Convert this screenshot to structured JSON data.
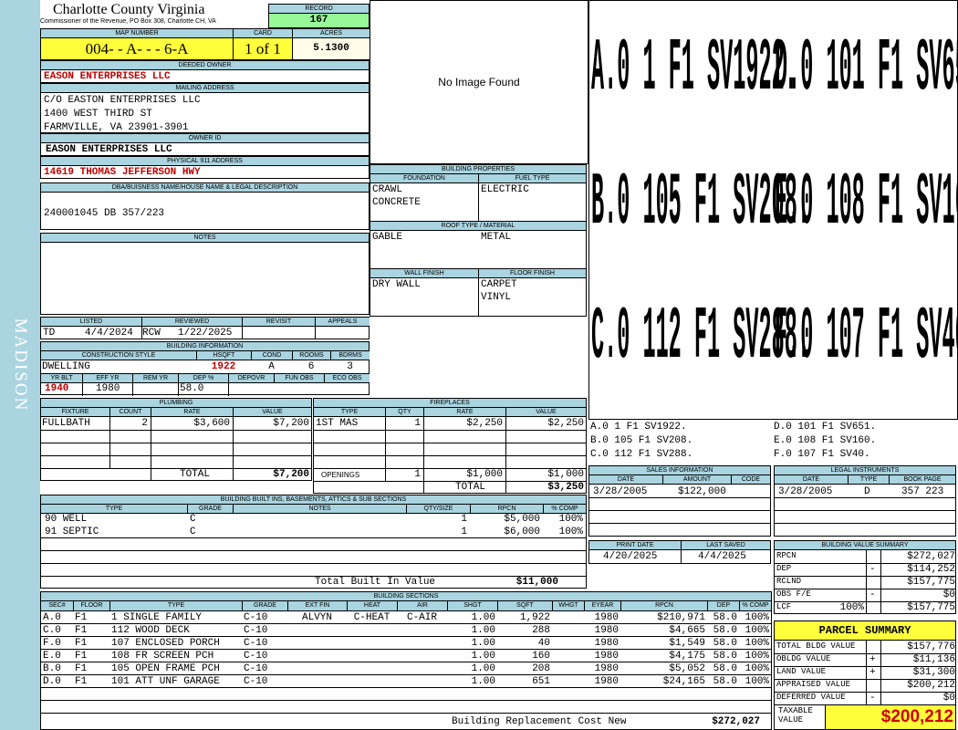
{
  "sidebar": {
    "label": "MADISON"
  },
  "header": {
    "county": "Charlotte County Virginia",
    "address": "Commissioner of the Revenue, PO Box 308, Charlotte CH, VA"
  },
  "record": {
    "label": "RECORD",
    "value": "167"
  },
  "map": {
    "label": "MAP NUMBER",
    "value": "004- - A- - - 6-A"
  },
  "card": {
    "label": "CARD",
    "value": "1 of 1"
  },
  "acres": {
    "label": "ACRES",
    "value": "5.1300"
  },
  "deeded_owner": {
    "label": "DEEDED OWNER",
    "value": "EASON ENTERPRISES LLC"
  },
  "mailing": {
    "label": "MAILING ADDRESS",
    "line1": "C/O EASTON ENTERPRISES LLC",
    "line2": "1400 WEST THIRD ST",
    "line3": "FARMVILLE, VA 23901-3901"
  },
  "owner_id": {
    "label": "OWNER ID",
    "value": "EASON ENTERPRISES LLC"
  },
  "physical": {
    "label": "PHYSICAL 911 ADDRESS",
    "value": "14619 THOMAS JEFFERSON HWY"
  },
  "dba": {
    "label": "DBA/BUISNESS NAME/HOUSE NAME & LEGAL DESCRIPTION",
    "value": "240001045 DB 357/223"
  },
  "notes": {
    "label": "NOTES"
  },
  "image": {
    "text": "No Image Found"
  },
  "building_props": {
    "title": "BUILDING PROPERTIES",
    "foundation_label": "FOUNDATION",
    "foundation1": "CRAWL",
    "foundation2": "CONCRETE",
    "fuel_label": "FUEL TYPE",
    "fuel": "ELECTRIC",
    "roof_label": "ROOF TYPE / MATERIAL",
    "roof_type": "GABLE",
    "roof_material": "METAL",
    "wall_label": "WALL FINISH",
    "wall": "DRY WALL",
    "floor_label": "FLOOR FINISH",
    "floor1": "CARPET",
    "floor2": "VINYL"
  },
  "sketch": {
    "labels": [
      "A.0 1 F1 SV1922.",
      "D.0 101 F1 SV651.",
      "B.0 105 F1 SV208.",
      "E.0 108 F1 SV160.",
      "C.0 112 F1 SV288.",
      "F.0 107 F1 SV40."
    ],
    "legend": [
      "A.0 1 F1 SV1922.",
      "D.0 101 F1 SV651.",
      "B.0 105 F1 SV208.",
      "E.0 108 F1 SV160.",
      "C.0 112 F1 SV288.",
      "F.0 107 F1 SV40."
    ]
  },
  "listed": {
    "listed_label": "LISTED",
    "reviewed_label": "REVIEWED",
    "revisit_label": "REVISIT",
    "appeals_label": "APPEALS",
    "listed_by": "TD",
    "listed_date": "4/4/2024",
    "reviewed_by": "RCW",
    "reviewed_date": "1/22/2025"
  },
  "building_info": {
    "title": "BUILDING INFORMATION",
    "style_label": "CONSTRUCTION STYLE",
    "style": "DWELLING",
    "hsqft_label": "HSQFT",
    "hsqft": "1922",
    "cond_label": "COND",
    "cond": "A",
    "rooms_label": "ROOMS",
    "rooms": "6",
    "bdrms_label": "BDRMS",
    "bdrms": "3",
    "yrblt_label": "YR BLT",
    "yrblt": "1940",
    "effyr_label": "EFF YR",
    "effyr": "1980",
    "remyr_label": "REM YR",
    "remyr": "",
    "dep_label": "DEP %",
    "dep": "58.0",
    "depovr_label": "DEPOVR",
    "funobs_label": "FUN OBS",
    "ecoobs_label": "ECO OBS"
  },
  "plumbing": {
    "title": "PLUMBING",
    "headers": [
      "FIXTURE",
      "COUNT",
      "RATE",
      "VALUE"
    ],
    "rows": [
      [
        "FULLBATH",
        "2",
        "$3,600",
        "$7,200"
      ]
    ],
    "total_label": "TOTAL",
    "total": "$7,200"
  },
  "fireplaces": {
    "title": "FIREPLACES",
    "headers": [
      "TYPE",
      "QTY",
      "RATE",
      "VALUE"
    ],
    "rows": [
      [
        "1ST MAS",
        "1",
        "$2,250",
        "$2,250"
      ]
    ],
    "openings_label": "OPENINGS",
    "openings_qty": "1",
    "openings_rate": "$1,000",
    "openings_value": "$1,000",
    "total_label": "TOTAL",
    "total": "$3,250"
  },
  "sales": {
    "title": "SALES INFORMATION",
    "headers": [
      "DATE",
      "AMOUNT",
      "CODE"
    ],
    "date": "3/28/2005",
    "amount": "$122,000",
    "code": ""
  },
  "legal": {
    "title": "LEGAL INSTRUMENTS",
    "headers": [
      "DATE",
      "TYPE",
      "BOOK PAGE"
    ],
    "date": "3/28/2005",
    "type": "D",
    "bookpage": "357 223"
  },
  "print": {
    "print_label": "PRINT DATE",
    "print_date": "4/20/2025",
    "saved_label": "LAST SAVED",
    "saved_date": "4/4/2025"
  },
  "builtins": {
    "title": "BUILDING BUILT INS, BASEMENTS, ATTICS & SUB SECTIONS",
    "headers": [
      "TYPE",
      "GRADE",
      "NOTES",
      "QTY/SIZE",
      "RPCN",
      "% COMP"
    ],
    "rows": [
      [
        "90 WELL",
        "C",
        "",
        "1",
        "$5,000",
        "100%"
      ],
      [
        "91 SEPTIC",
        "C",
        "",
        "1",
        "$6,000",
        "100%"
      ]
    ],
    "total_label": "Total Built In Value",
    "total": "$11,000"
  },
  "bvs": {
    "title": "BUILDING VALUE SUMMARY",
    "rpcn_label": "RPCN",
    "rpcn": "$272,027",
    "dep_label": "DEP",
    "dep_sign": "-",
    "dep": "$114,252",
    "rclnd_label": "RCLND",
    "rclnd": "$157,775",
    "obs_label": "OBS F/E",
    "obs_sign": "-",
    "obs": "$0",
    "lcf_label": "LCF",
    "lcf_pct": "100%",
    "lcf": "$157,775"
  },
  "sections": {
    "title": "BUILDING SECTIONS",
    "headers": [
      "SEC#",
      "FLOOR",
      "TYPE",
      "GRADE",
      "EXT FIN",
      "HEAT",
      "AIR",
      "SHGT",
      "SQFT",
      "WHGT",
      "EYEAR",
      "RPCN",
      "DEP",
      "% COMP"
    ],
    "rows": [
      [
        "A.0",
        "F1",
        "1 SINGLE FAMILY",
        "C-10",
        "ALVYN",
        "C-HEAT",
        "C-AIR",
        "1.00",
        "1,922",
        "",
        "1980",
        "$210,971",
        "58.0",
        "100%"
      ],
      [
        "C.0",
        "F1",
        "112 WOOD DECK",
        "C-10",
        "",
        "",
        "",
        "1.00",
        "288",
        "",
        "1980",
        "$4,665",
        "58.0",
        "100%"
      ],
      [
        "F.0",
        "F1",
        "107 ENCLOSED PORCH",
        "C-10",
        "",
        "",
        "",
        "1.00",
        "40",
        "",
        "1980",
        "$1,549",
        "58.0",
        "100%"
      ],
      [
        "E.0",
        "F1",
        "108 FR SCREEN PCH",
        "C-10",
        "",
        "",
        "",
        "1.00",
        "160",
        "",
        "1980",
        "$4,175",
        "58.0",
        "100%"
      ],
      [
        "B.0",
        "F1",
        "105 OPEN FRAME PCH",
        "C-10",
        "",
        "",
        "",
        "1.00",
        "208",
        "",
        "1980",
        "$5,052",
        "58.0",
        "100%"
      ],
      [
        "D.0",
        "F1",
        "101 ATT UNF GARAGE",
        "C-10",
        "",
        "",
        "",
        "1.00",
        "651",
        "",
        "1980",
        "$24,165",
        "58.0",
        "100%"
      ]
    ],
    "total_label": "Building Replacement Cost New",
    "total": "$272,027"
  },
  "parcel": {
    "title": "PARCEL SUMMARY",
    "bldg_label": "TOTAL BLDG VALUE",
    "bldg": "$157,776",
    "obldg_label": "OBLDG VALUE",
    "obldg_sign": "+",
    "obldg": "$11,136",
    "land_label": "LAND VALUE",
    "land_sign": "+",
    "land": "$31,300",
    "appraised_label": "APPRAISED VALUE",
    "appraised": "$200,212",
    "deferred_label": "DEFERRED VALUE",
    "deferred_sign": "-",
    "deferred": "$0",
    "taxable_label1": "TAXABLE",
    "taxable_label2": "VALUE",
    "taxable": "$200,212"
  }
}
